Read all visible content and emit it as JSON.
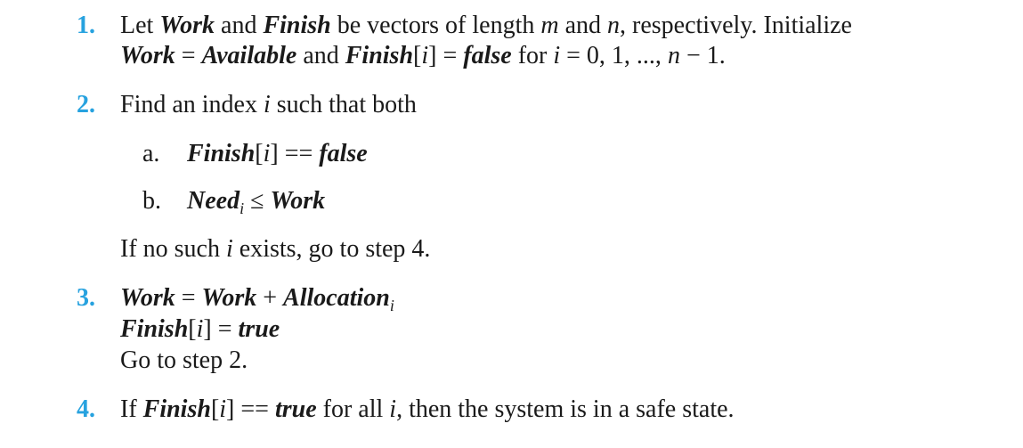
{
  "accent_color": "#27a2df",
  "lines": [
    {
      "marker": "1.",
      "marker_type": "step",
      "segments": [
        {
          "t": "Let ",
          "s": "r"
        },
        {
          "t": "Work",
          "s": "bi"
        },
        {
          "t": " and ",
          "s": "r"
        },
        {
          "t": "Finish",
          "s": "bi"
        },
        {
          "t": " be vectors of length ",
          "s": "r"
        },
        {
          "t": "m",
          "s": "i"
        },
        {
          "t": " and ",
          "s": "r"
        },
        {
          "t": "n",
          "s": "i"
        },
        {
          "t": ", respectively. Initialize",
          "s": "r"
        }
      ]
    },
    {
      "segments": [
        {
          "t": "Work",
          "s": "bi"
        },
        {
          "t": " = ",
          "s": "r"
        },
        {
          "t": "Available",
          "s": "bi"
        },
        {
          "t": " and ",
          "s": "r"
        },
        {
          "t": "Finish",
          "s": "bi"
        },
        {
          "t": "[",
          "s": "r"
        },
        {
          "t": "i",
          "s": "i"
        },
        {
          "t": "] = ",
          "s": "r"
        },
        {
          "t": "false",
          "s": "bi"
        },
        {
          "t": " for ",
          "s": "r"
        },
        {
          "t": "i",
          "s": "i"
        },
        {
          "t": " = 0, 1, ..., ",
          "s": "r"
        },
        {
          "t": "n",
          "s": "i"
        },
        {
          "t": " − 1.",
          "s": "r"
        }
      ]
    },
    {
      "marker": "2.",
      "marker_type": "step",
      "segments": [
        {
          "t": "Find an index ",
          "s": "r"
        },
        {
          "t": "i",
          "s": "i"
        },
        {
          "t": " such that both",
          "s": "r"
        }
      ]
    },
    {
      "marker": "a.",
      "marker_type": "sub",
      "segments": [
        {
          "t": "Finish",
          "s": "bi"
        },
        {
          "t": "[",
          "s": "r"
        },
        {
          "t": "i",
          "s": "i"
        },
        {
          "t": "] == ",
          "s": "r"
        },
        {
          "t": "false",
          "s": "bi"
        }
      ]
    },
    {
      "marker": "b.",
      "marker_type": "sub",
      "segments": [
        {
          "t": "Need",
          "s": "bi"
        },
        {
          "t": "i",
          "s": "sub"
        },
        {
          "t": " ≤ ",
          "s": "r"
        },
        {
          "t": "Work",
          "s": "bi"
        }
      ]
    },
    {
      "segments": [
        {
          "t": "If no such ",
          "s": "r"
        },
        {
          "t": "i",
          "s": "i"
        },
        {
          "t": " exists, go to step 4.",
          "s": "r"
        }
      ]
    },
    {
      "marker": "3.",
      "marker_type": "step",
      "segments": [
        {
          "t": "Work",
          "s": "bi"
        },
        {
          "t": " = ",
          "s": "r"
        },
        {
          "t": "Work",
          "s": "bi"
        },
        {
          "t": " + ",
          "s": "r"
        },
        {
          "t": "Allocation",
          "s": "bi"
        },
        {
          "t": "i",
          "s": "sub"
        }
      ]
    },
    {
      "segments": [
        {
          "t": "Finish",
          "s": "bi"
        },
        {
          "t": "[",
          "s": "r"
        },
        {
          "t": "i",
          "s": "i"
        },
        {
          "t": "] = ",
          "s": "r"
        },
        {
          "t": "true",
          "s": "bi"
        }
      ]
    },
    {
      "segments": [
        {
          "t": "Go to step 2.",
          "s": "r"
        }
      ]
    },
    {
      "marker": "4.",
      "marker_type": "step",
      "segments": [
        {
          "t": "If ",
          "s": "r"
        },
        {
          "t": "Finish",
          "s": "bi"
        },
        {
          "t": "[",
          "s": "r"
        },
        {
          "t": "i",
          "s": "i"
        },
        {
          "t": "] == ",
          "s": "r"
        },
        {
          "t": "true",
          "s": "bi"
        },
        {
          "t": " for all ",
          "s": "r"
        },
        {
          "t": "i",
          "s": "i"
        },
        {
          "t": ", then the system is in a safe state.",
          "s": "r"
        }
      ]
    }
  ]
}
